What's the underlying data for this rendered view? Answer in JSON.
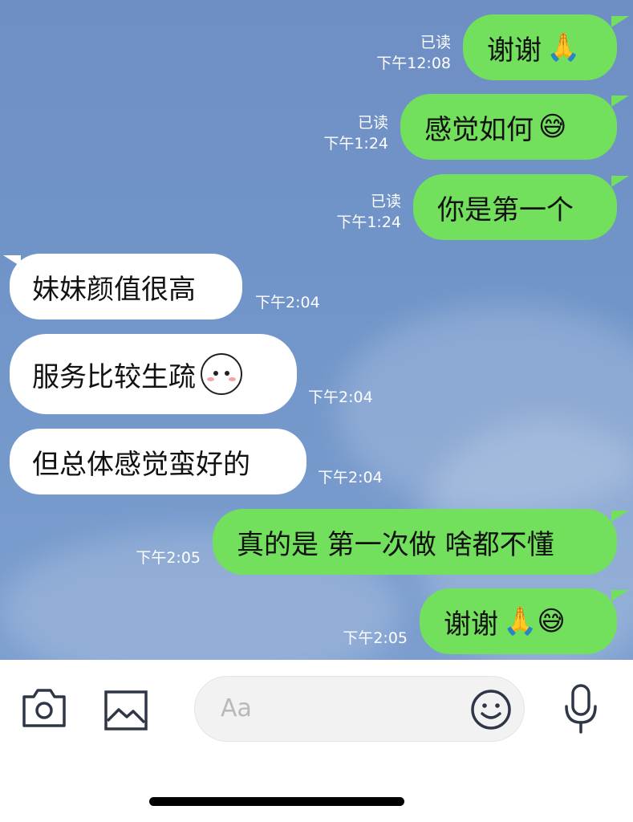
{
  "messages": [
    {
      "dir": "out",
      "text": "谢谢",
      "emoji": "🙏",
      "read": "已读",
      "time": "下午12:08"
    },
    {
      "dir": "out",
      "text": "感觉如何",
      "emoji": "😅",
      "read": "已读",
      "time": "下午1:24"
    },
    {
      "dir": "out",
      "text": "你是第一个",
      "read": "已读",
      "time": "下午1:24"
    },
    {
      "dir": "in",
      "text": "妹妹颜值很高",
      "time": "下午2:04"
    },
    {
      "dir": "in",
      "text": "服务比较生疏",
      "time": "下午2:04"
    },
    {
      "dir": "in",
      "text": "但总体感觉蛮好的",
      "time": "下午2:04"
    },
    {
      "dir": "out",
      "text": "真的是 第一次做 啥都不懂",
      "time": "下午2:05"
    },
    {
      "dir": "out",
      "text": "谢谢",
      "emoji": "🙏😅",
      "time": "下午2:05"
    }
  ],
  "composer": {
    "placeholder": "Aa"
  },
  "icons": [
    "camera-icon",
    "image-icon",
    "emoji-icon",
    "microphone-icon"
  ]
}
